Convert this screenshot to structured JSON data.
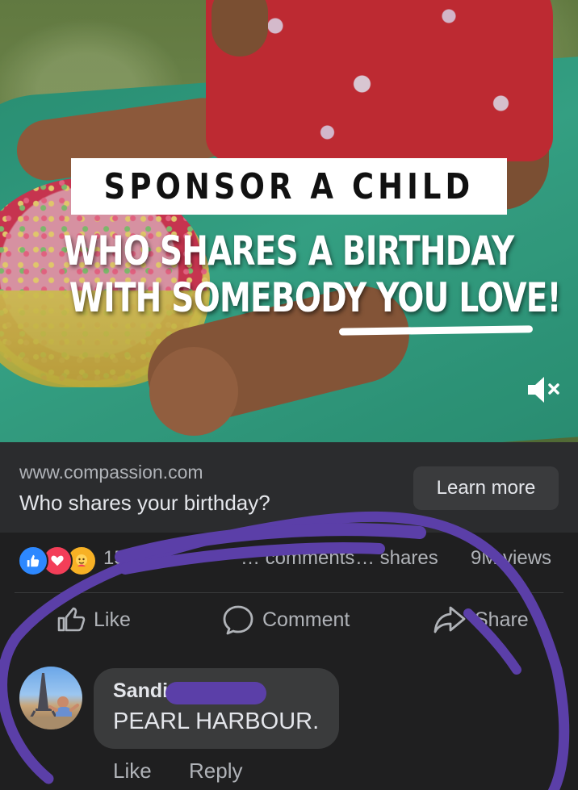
{
  "video": {
    "headline": "SPONSOR A CHILD",
    "subline_1": "WHO SHARES A BIRTHDAY",
    "subline_2": "WITH SOMEBODY YOU LOVE!",
    "mute_icon": "speaker-muted-icon"
  },
  "link": {
    "url": "www.compassion.com",
    "title": "Who shares your birthday?",
    "cta_label": "Learn more"
  },
  "stats": {
    "reaction_icons": [
      "like-reaction-icon",
      "love-reaction-icon",
      "care-reaction-icon"
    ],
    "reaction_count": "15K",
    "comments": "… comments",
    "shares": "… shares",
    "views": "9M views"
  },
  "actions": {
    "like_label": "Like",
    "comment_label": "Comment",
    "share_label": "Share"
  },
  "comment": {
    "author": "Sandi",
    "text": "PEARL HARBOUR.",
    "like_label": "Like",
    "reply_label": "Reply"
  },
  "colors": {
    "background": "#1f1f20",
    "link_bar": "#2b2c2e",
    "annotation": "#5b3fa8",
    "like_blue": "#2d88ff",
    "love_red": "#f33e58"
  }
}
